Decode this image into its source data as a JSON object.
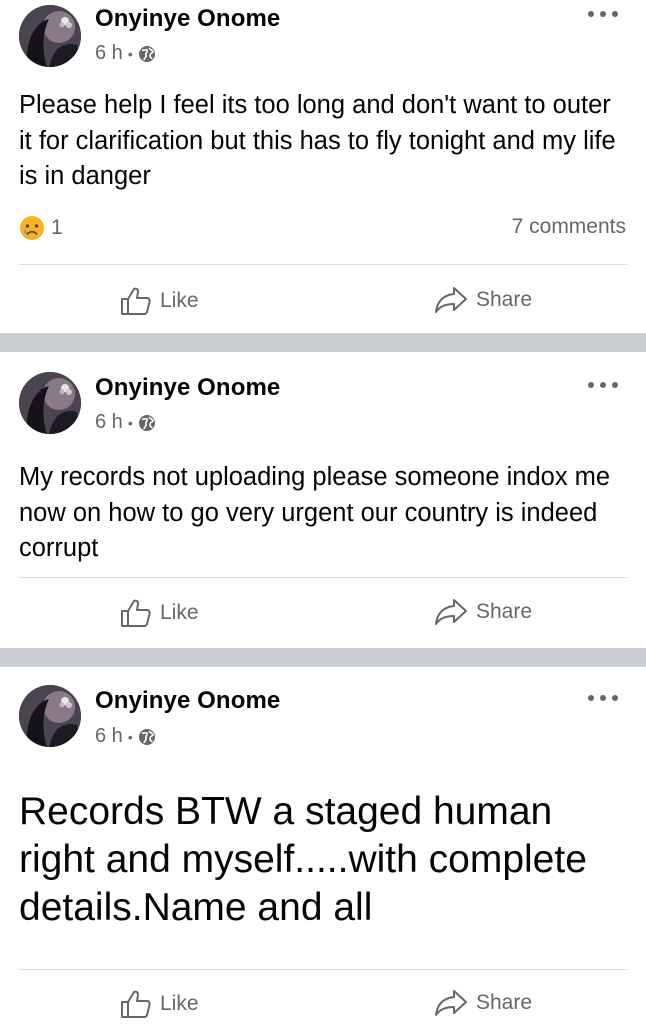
{
  "posts": [
    {
      "author": "Onyinye Onome",
      "time": "6 h",
      "text": "Please help I feel its too long and don't want to outer it for clarification but this has to fly tonight and my life is in danger",
      "reaction_count": "1",
      "comments": "7 comments",
      "like_label": "Like",
      "share_label": "Share"
    },
    {
      "author": "Onyinye Onome",
      "time": "6 h",
      "text": "My records not uploading please someone indox me now on how to go very urgent our country is indeed corrupt",
      "like_label": "Like",
      "share_label": "Share"
    },
    {
      "author": "Onyinye Onome",
      "time": "6 h",
      "text": "Records BTW a staged human right and myself.....with complete details.Name and all",
      "like_label": "Like",
      "share_label": "Share"
    }
  ],
  "icons": {
    "privacy": "globe-icon",
    "reaction": "sad-face-icon",
    "more": "more-options-icon",
    "like": "thumbs-up-icon",
    "share": "share-arrow-icon"
  },
  "colors": {
    "text_primary": "#050505",
    "text_secondary": "#65676b",
    "separator": "#cacdd2",
    "divider": "#dadde1",
    "sad_emoji": "#f7b125"
  }
}
